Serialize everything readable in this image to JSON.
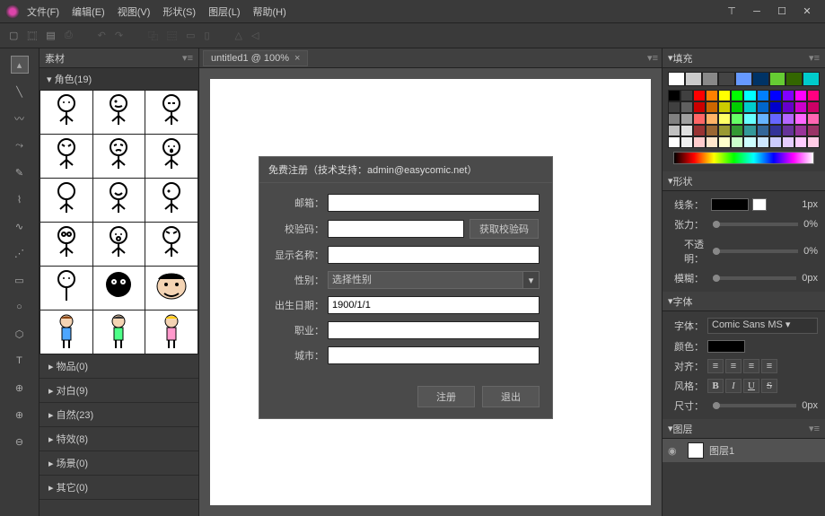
{
  "menus": [
    "文件(F)",
    "编辑(E)",
    "视图(V)",
    "形状(S)",
    "图层(L)",
    "帮助(H)"
  ],
  "panels": {
    "material": "素材",
    "fill": "填充",
    "shape": "形状",
    "font": "字体",
    "layer": "图层"
  },
  "categories": {
    "role": "角色(19)",
    "item": "物品(0)",
    "dialog": "对白(9)",
    "nature": "自然(23)",
    "effect": "特效(8)",
    "scene": "场景(0)",
    "other": "其它(0)"
  },
  "tab": {
    "title": "untitled1 @ 100%"
  },
  "dialog": {
    "title": "免费注册（技术支持：admin@easycomic.net）",
    "labels": {
      "email": "邮箱：",
      "code": "校验码：",
      "getcode": "获取校验码",
      "nickname": "显示名称：",
      "gender": "性别：",
      "gender_placeholder": "选择性别",
      "birthday": "出生日期：",
      "birthday_value": "1900/1/1",
      "job": "职业：",
      "city": "城市：",
      "register": "注册",
      "exit": "退出"
    }
  },
  "shape": {
    "stroke_label": "线条：",
    "stroke_width": "1px",
    "tension_label": "张力：",
    "tension_val": "0%",
    "opacity_label": "不透明：",
    "opacity_val": "0%",
    "blur_label": "模糊：",
    "blur_val": "0px"
  },
  "font": {
    "family_label": "字体：",
    "family_value": "Comic Sans MS",
    "color_label": "颜色：",
    "align_label": "对齐：",
    "style_label": "风格：",
    "size_label": "尺寸：",
    "size_val": "0px",
    "styles": {
      "b": "B",
      "i": "I",
      "u": "U",
      "s": "S"
    }
  },
  "layer": {
    "name": "图层1"
  },
  "palette_top": [
    "#ffffff",
    "#cccccc",
    "#888888",
    "#444444",
    "#6699ff",
    "#003366",
    "#66cc33",
    "#336600",
    "#00cccc"
  ],
  "palette": [
    "#000000",
    "#404040",
    "#ff0000",
    "#ff8000",
    "#ffff00",
    "#00ff00",
    "#00ffff",
    "#0080ff",
    "#0000ff",
    "#8000ff",
    "#ff00ff",
    "#ff0080",
    "#404040",
    "#606060",
    "#cc0000",
    "#cc6600",
    "#cccc00",
    "#00cc00",
    "#00cccc",
    "#0066cc",
    "#0000cc",
    "#6600cc",
    "#cc00cc",
    "#cc0066",
    "#808080",
    "#a0a0a0",
    "#ff6666",
    "#ffb366",
    "#ffff66",
    "#66ff66",
    "#66ffff",
    "#66b3ff",
    "#6666ff",
    "#b366ff",
    "#ff66ff",
    "#ff66b3",
    "#c0c0c0",
    "#e0e0e0",
    "#993333",
    "#996633",
    "#999933",
    "#339933",
    "#339999",
    "#336699",
    "#333399",
    "#663399",
    "#993399",
    "#993366",
    "#ffffff",
    "#f0f0f0",
    "#ffcccc",
    "#ffe6cc",
    "#ffffcc",
    "#ccffcc",
    "#ccffff",
    "#cce6ff",
    "#ccccff",
    "#e6ccff",
    "#ffccff",
    "#ffcce6"
  ]
}
